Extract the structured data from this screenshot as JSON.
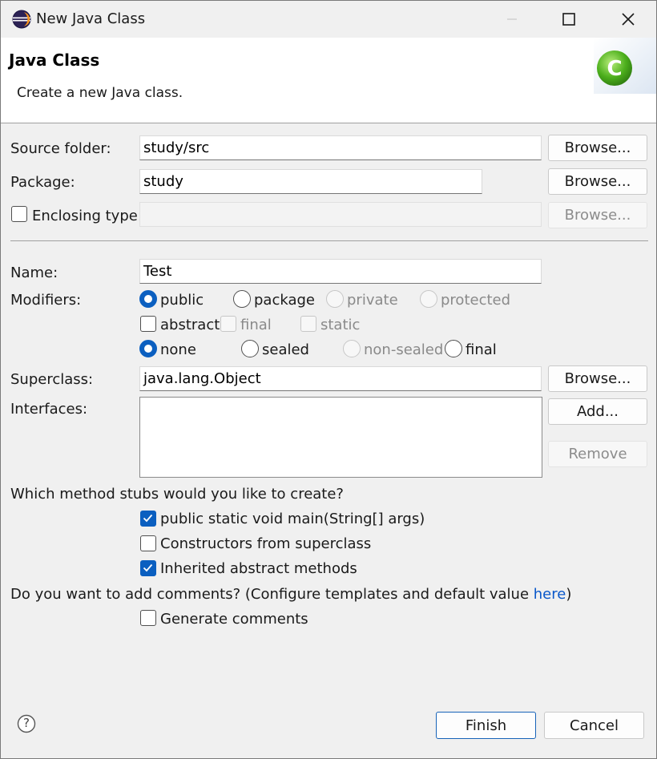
{
  "window": {
    "title": "New Java Class"
  },
  "header": {
    "title": "Java Class",
    "description": "Create a new Java class."
  },
  "source_folder": {
    "label": "Source folder:",
    "value": "study/src",
    "browse_label": "Browse..."
  },
  "package": {
    "label": "Package:",
    "value": "study",
    "browse_label": "Browse..."
  },
  "enclosing_type": {
    "label": "Enclosing type:",
    "checked": false,
    "value": "",
    "browse_label": "Browse..."
  },
  "name": {
    "label": "Name:",
    "value": "Test"
  },
  "modifiers": {
    "label": "Modifiers:",
    "access": [
      {
        "label": "public",
        "selected": true,
        "enabled": true
      },
      {
        "label": "package",
        "selected": false,
        "enabled": true
      },
      {
        "label": "private",
        "selected": false,
        "enabled": false
      },
      {
        "label": "protected",
        "selected": false,
        "enabled": false
      }
    ],
    "flags": [
      {
        "label": "abstract",
        "checked": false,
        "enabled": true
      },
      {
        "label": "final",
        "checked": false,
        "enabled": false
      },
      {
        "label": "static",
        "checked": false,
        "enabled": false
      }
    ],
    "sealing": [
      {
        "label": "none",
        "selected": true,
        "enabled": true
      },
      {
        "label": "sealed",
        "selected": false,
        "enabled": true
      },
      {
        "label": "non-sealed",
        "selected": false,
        "enabled": false
      },
      {
        "label": "final",
        "selected": false,
        "enabled": true
      }
    ]
  },
  "superclass": {
    "label": "Superclass:",
    "value": "java.lang.Object",
    "browse_label": "Browse..."
  },
  "interfaces": {
    "label": "Interfaces:",
    "add_label": "Add...",
    "remove_label": "Remove"
  },
  "method_stubs": {
    "question": "Which method stubs would you like to create?",
    "options": [
      {
        "label": "public static void main(String[] args)",
        "checked": true
      },
      {
        "label": "Constructors from superclass",
        "checked": false
      },
      {
        "label": "Inherited abstract methods",
        "checked": true
      }
    ]
  },
  "comments": {
    "question_prefix": "Do you want to add comments? (Configure templates and default value ",
    "link_text": "here",
    "question_suffix": ")",
    "option": {
      "label": "Generate comments",
      "checked": false
    }
  },
  "footer": {
    "help_icon": "?",
    "finish_label": "Finish",
    "cancel_label": "Cancel"
  },
  "colors": {
    "accent": "#0b5fc0",
    "link": "#0a58ca",
    "eclipse_purple": "#2c2255",
    "class_icon_green": "#4caf1c"
  }
}
